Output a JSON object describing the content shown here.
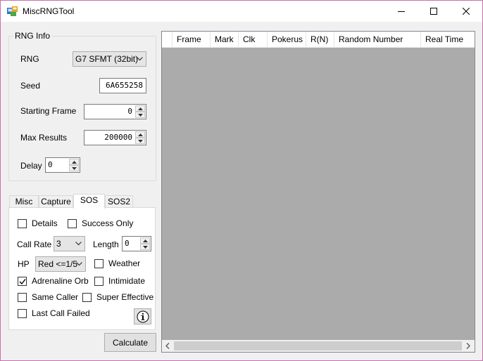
{
  "window": {
    "title": "MiscRNGTool"
  },
  "rng_info": {
    "legend": "RNG Info",
    "rng_label": "RNG",
    "rng_value": "G7 SFMT (32bit)",
    "seed_label": "Seed",
    "seed_value": "6A655258",
    "starting_frame_label": "Starting Frame",
    "starting_frame_value": "0",
    "max_results_label": "Max Results",
    "max_results_value": "200000",
    "delay_label": "Delay",
    "delay_value": "0"
  },
  "tabs": [
    {
      "label": "Misc"
    },
    {
      "label": "Capture"
    },
    {
      "label": "SOS"
    },
    {
      "label": "SOS2"
    }
  ],
  "active_tab": "SOS",
  "sos": {
    "details": {
      "label": "Details",
      "checked": false
    },
    "success_only": {
      "label": "Success Only",
      "checked": false
    },
    "call_rate_label": "Call Rate",
    "call_rate_value": "3",
    "length_label": "Length",
    "length_value": "0",
    "hp_label": "HP",
    "hp_value": "Red <=1/5",
    "weather": {
      "label": "Weather",
      "checked": false
    },
    "adrenaline_orb": {
      "label": "Adrenaline Orb",
      "checked": true
    },
    "intimidate": {
      "label": "Intimidate",
      "checked": false
    },
    "same_caller": {
      "label": "Same Caller",
      "checked": false
    },
    "super_effective": {
      "label": "Super Effective",
      "checked": false
    },
    "last_call_failed": {
      "label": "Last Call Failed",
      "checked": false
    }
  },
  "calculate_label": "Calculate",
  "grid": {
    "columns": [
      "Frame",
      "Mark",
      "Clk",
      "Pokerus",
      "R(N)",
      "Random Number",
      "Real Time"
    ]
  },
  "icons": {
    "app": "app-icon",
    "info": "info-icon"
  }
}
